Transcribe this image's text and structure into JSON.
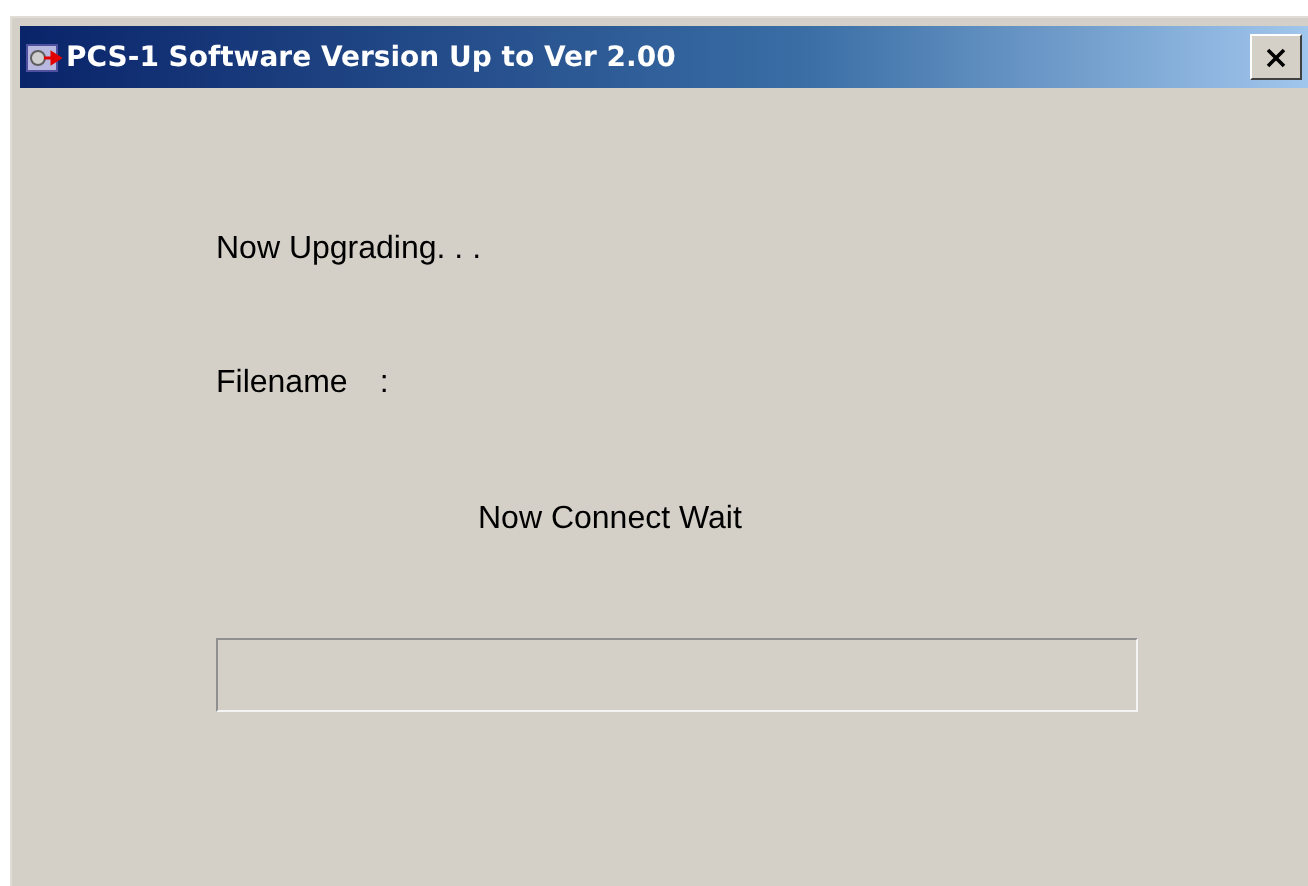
{
  "window": {
    "title": "PCS-1 Software Version Up to Ver 2.00"
  },
  "status": "Now Upgrading. . .",
  "filename": {
    "label": "Filename",
    "separator": ":"
  },
  "message": "Now Connect Wait",
  "progress": {
    "level": 0
  }
}
